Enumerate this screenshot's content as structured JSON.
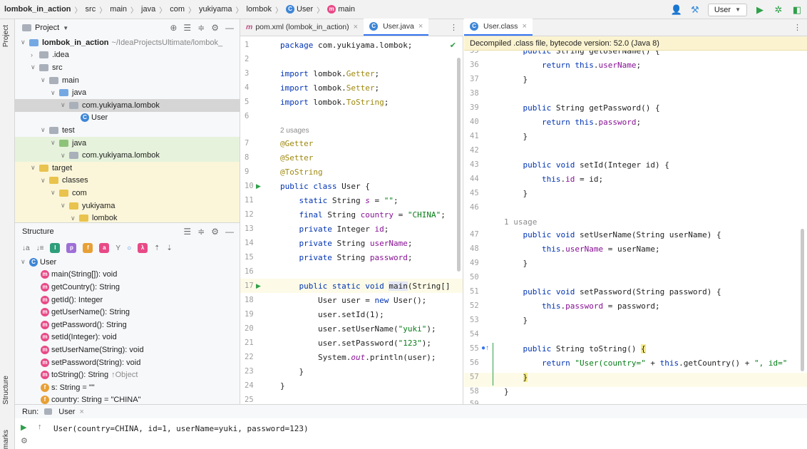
{
  "navbar": {
    "crumbs": [
      "lombok_in_action",
      "src",
      "main",
      "java",
      "com",
      "yukiyama",
      "lombok",
      "User",
      "main"
    ],
    "run_config": "User"
  },
  "stripe": {
    "top_label": "Project",
    "bottom_label": "Structure",
    "bookmarks_label": "Bookmarks"
  },
  "project_panel": {
    "title": "Project",
    "tree": [
      {
        "label": "lombok_in_action",
        "extra": "~/IdeaProjectsUltimate/lombok_"
      },
      {
        "label": ".idea"
      },
      {
        "label": "src"
      },
      {
        "label": "main"
      },
      {
        "label": "java"
      },
      {
        "label": "com.yukiyama.lombok"
      },
      {
        "label": "User"
      },
      {
        "label": "test"
      },
      {
        "label": "java"
      },
      {
        "label": "com.yukiyama.lombok"
      },
      {
        "label": "target"
      },
      {
        "label": "classes"
      },
      {
        "label": "com"
      },
      {
        "label": "yukiyama"
      },
      {
        "label": "lombok"
      }
    ]
  },
  "structure_panel": {
    "title": "Structure",
    "root": "User",
    "members": [
      "main(String[]): void",
      "getCountry(): String",
      "getId(): Integer",
      "getUserName(): String",
      "getPassword(): String",
      "setId(Integer): void",
      "setUserName(String): void",
      "setPassword(String): void",
      "toString(): String",
      "s: String = \"\"",
      "country: String = \"CHINA\""
    ],
    "tostring_suffix": "↑Object"
  },
  "editor_tabs": [
    {
      "label": "pom.xml (lombok_in_action)"
    },
    {
      "label": "User.java"
    }
  ],
  "editor": {
    "lines": [
      {
        "n": "1",
        "code": "package com.yukiyama.lombok;"
      },
      {
        "n": "2",
        "code": ""
      },
      {
        "n": "3",
        "code": "import lombok.Getter;"
      },
      {
        "n": "4",
        "code": "import lombok.Setter;"
      },
      {
        "n": "5",
        "code": "import lombok.ToString;"
      },
      {
        "n": "6",
        "code": ""
      },
      {
        "n": "",
        "code": "2 usages"
      },
      {
        "n": "7",
        "code": "@Getter"
      },
      {
        "n": "8",
        "code": "@Setter"
      },
      {
        "n": "9",
        "code": "@ToString"
      },
      {
        "n": "10",
        "code": "public class User {"
      },
      {
        "n": "11",
        "code": "    static String s = \"\";"
      },
      {
        "n": "12",
        "code": "    final String country = \"CHINA\";"
      },
      {
        "n": "13",
        "code": "    private Integer id;"
      },
      {
        "n": "14",
        "code": "    private String userName;"
      },
      {
        "n": "15",
        "code": "    private String password;"
      },
      {
        "n": "16",
        "code": ""
      },
      {
        "n": "17",
        "code": "    public static void main(String[]"
      },
      {
        "n": "18",
        "code": "        User user = new User();"
      },
      {
        "n": "19",
        "code": "        user.setId(1);"
      },
      {
        "n": "20",
        "code": "        user.setUserName(\"yuki\");"
      },
      {
        "n": "21",
        "code": "        user.setPassword(\"123\");"
      },
      {
        "n": "22",
        "code": "        System.out.println(user);"
      },
      {
        "n": "23",
        "code": "    }"
      },
      {
        "n": "24",
        "code": "}"
      },
      {
        "n": "25",
        "code": ""
      }
    ]
  },
  "right_tab": {
    "label": "User.class"
  },
  "decompiled_banner": "Decompiled .class file, bytecode version: 52.0 (Java 8)",
  "right_editor": {
    "lines": [
      {
        "n": "35",
        "code": "    public String getUserName() {"
      },
      {
        "n": "36",
        "code": "        return this.userName;"
      },
      {
        "n": "37",
        "code": "    }"
      },
      {
        "n": "38",
        "code": ""
      },
      {
        "n": "39",
        "code": "    public String getPassword() {"
      },
      {
        "n": "40",
        "code": "        return this.password;"
      },
      {
        "n": "41",
        "code": "    }"
      },
      {
        "n": "42",
        "code": ""
      },
      {
        "n": "43",
        "code": "    public void setId(Integer id) {"
      },
      {
        "n": "44",
        "code": "        this.id = id;"
      },
      {
        "n": "45",
        "code": "    }"
      },
      {
        "n": "46",
        "code": ""
      },
      {
        "n": "",
        "code": "1 usage"
      },
      {
        "n": "47",
        "code": "    public void setUserName(String userName) {"
      },
      {
        "n": "48",
        "code": "        this.userName = userName;"
      },
      {
        "n": "49",
        "code": "    }"
      },
      {
        "n": "50",
        "code": ""
      },
      {
        "n": "51",
        "code": "    public void setPassword(String password) {"
      },
      {
        "n": "52",
        "code": "        this.password = password;"
      },
      {
        "n": "53",
        "code": "    }"
      },
      {
        "n": "54",
        "code": ""
      },
      {
        "n": "55",
        "code": "    public String toString() {"
      },
      {
        "n": "56",
        "code": "        return \"User(country=\" + this.getCountry() + \", id="
      },
      {
        "n": "57",
        "code": "    }"
      },
      {
        "n": "58",
        "code": "}"
      },
      {
        "n": "59",
        "code": ""
      }
    ]
  },
  "run_panel": {
    "label": "Run:",
    "tab": "User",
    "output": "User(country=CHINA, id=1, userName=yuki, password=123)"
  },
  "colors": {
    "keyword": "#0033b3",
    "annotation": "#9e880d",
    "string": "#067d17",
    "field": "#871094",
    "accent": "#3574f0"
  }
}
